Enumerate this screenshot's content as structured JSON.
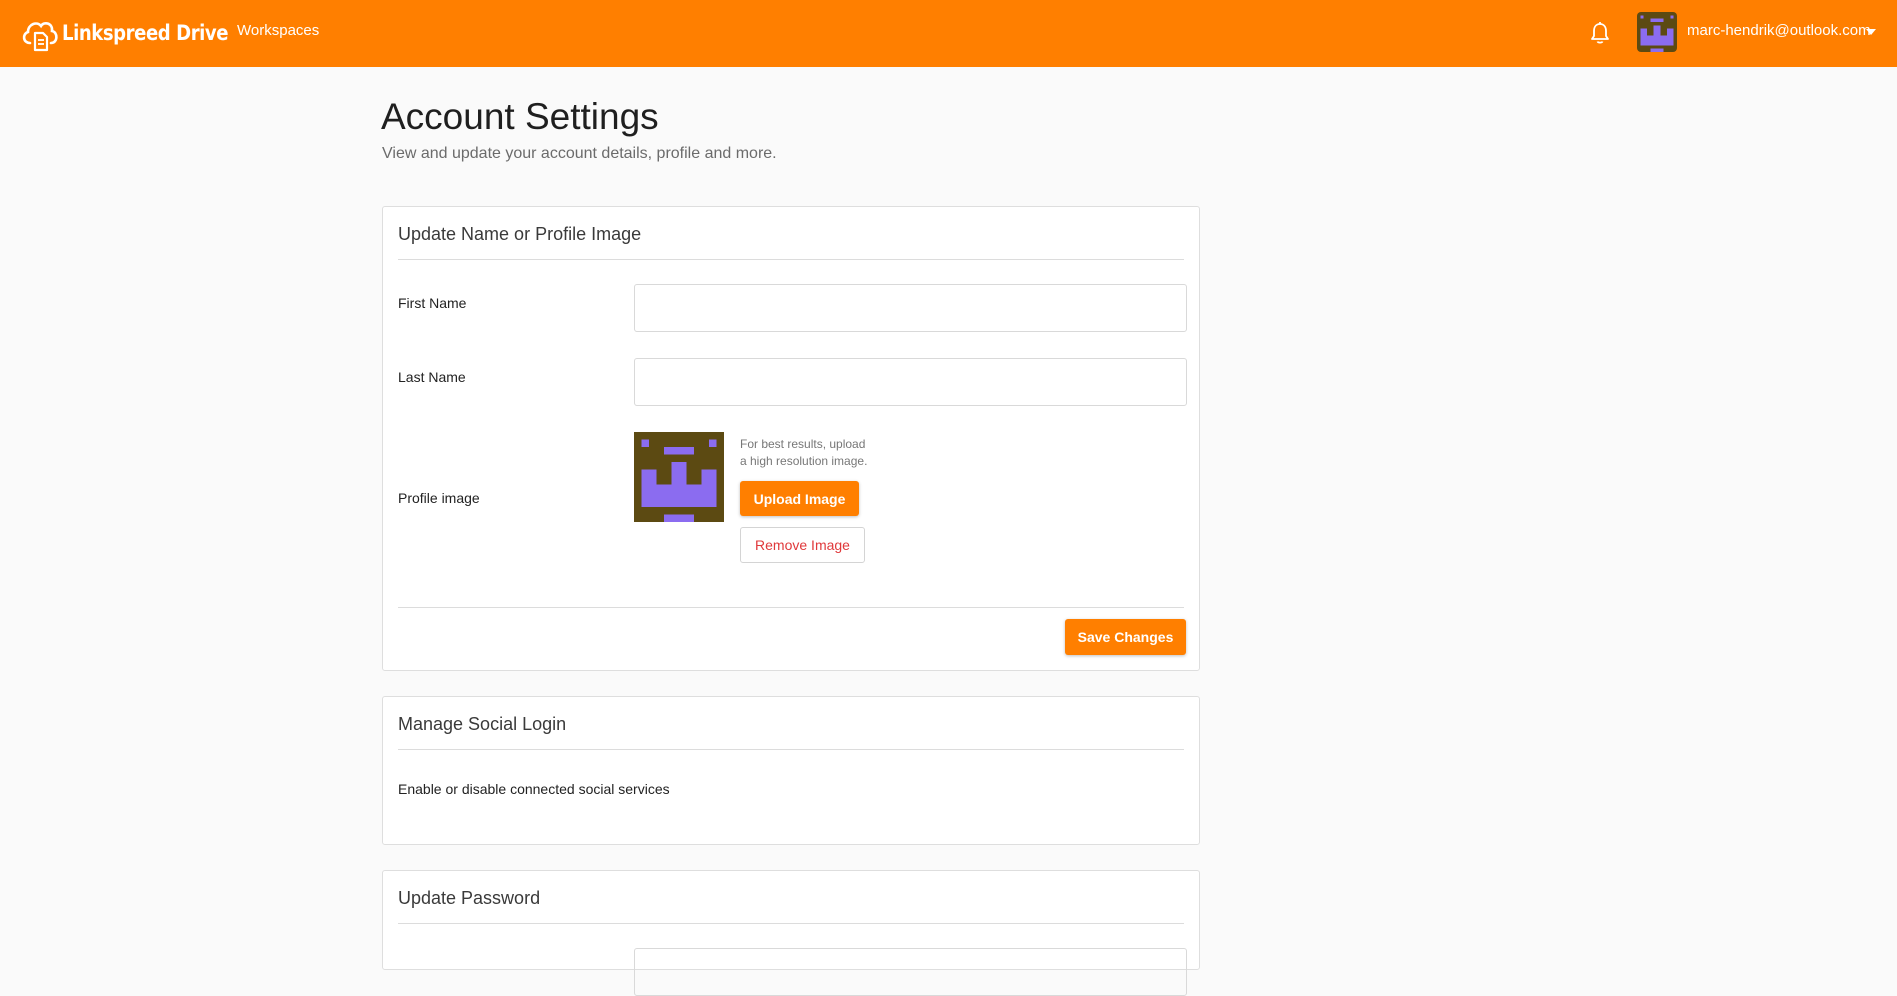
{
  "topbar": {
    "app_name": "Linkspreed Drive",
    "nav_workspaces": "Workspaces",
    "user_email": "marc-hendrik@outlook.com",
    "accent_color": "#ff7f00",
    "icons": {
      "logo": "cloud-document-icon",
      "notifications": "bell-icon",
      "menu": "caret-down-icon"
    }
  },
  "page": {
    "title": "Account Settings",
    "subtitle": "View and update your account details, profile and more."
  },
  "profile_card": {
    "title": "Update Name or Profile Image",
    "first_name_label": "First Name",
    "first_name_value": "",
    "last_name_label": "Last Name",
    "last_name_value": "",
    "profile_image_label": "Profile image",
    "hint_line1": "For best results, upload",
    "hint_line2": "a high resolution image.",
    "upload_button": "Upload Image",
    "remove_button": "Remove Image",
    "save_button": "Save Changes"
  },
  "social_card": {
    "title": "Manage Social Login",
    "description": "Enable or disable connected social services"
  },
  "password_card": {
    "title": "Update Password"
  },
  "avatar_colors": {
    "background": "#5c4a12",
    "foreground": "#8b6cf0"
  }
}
